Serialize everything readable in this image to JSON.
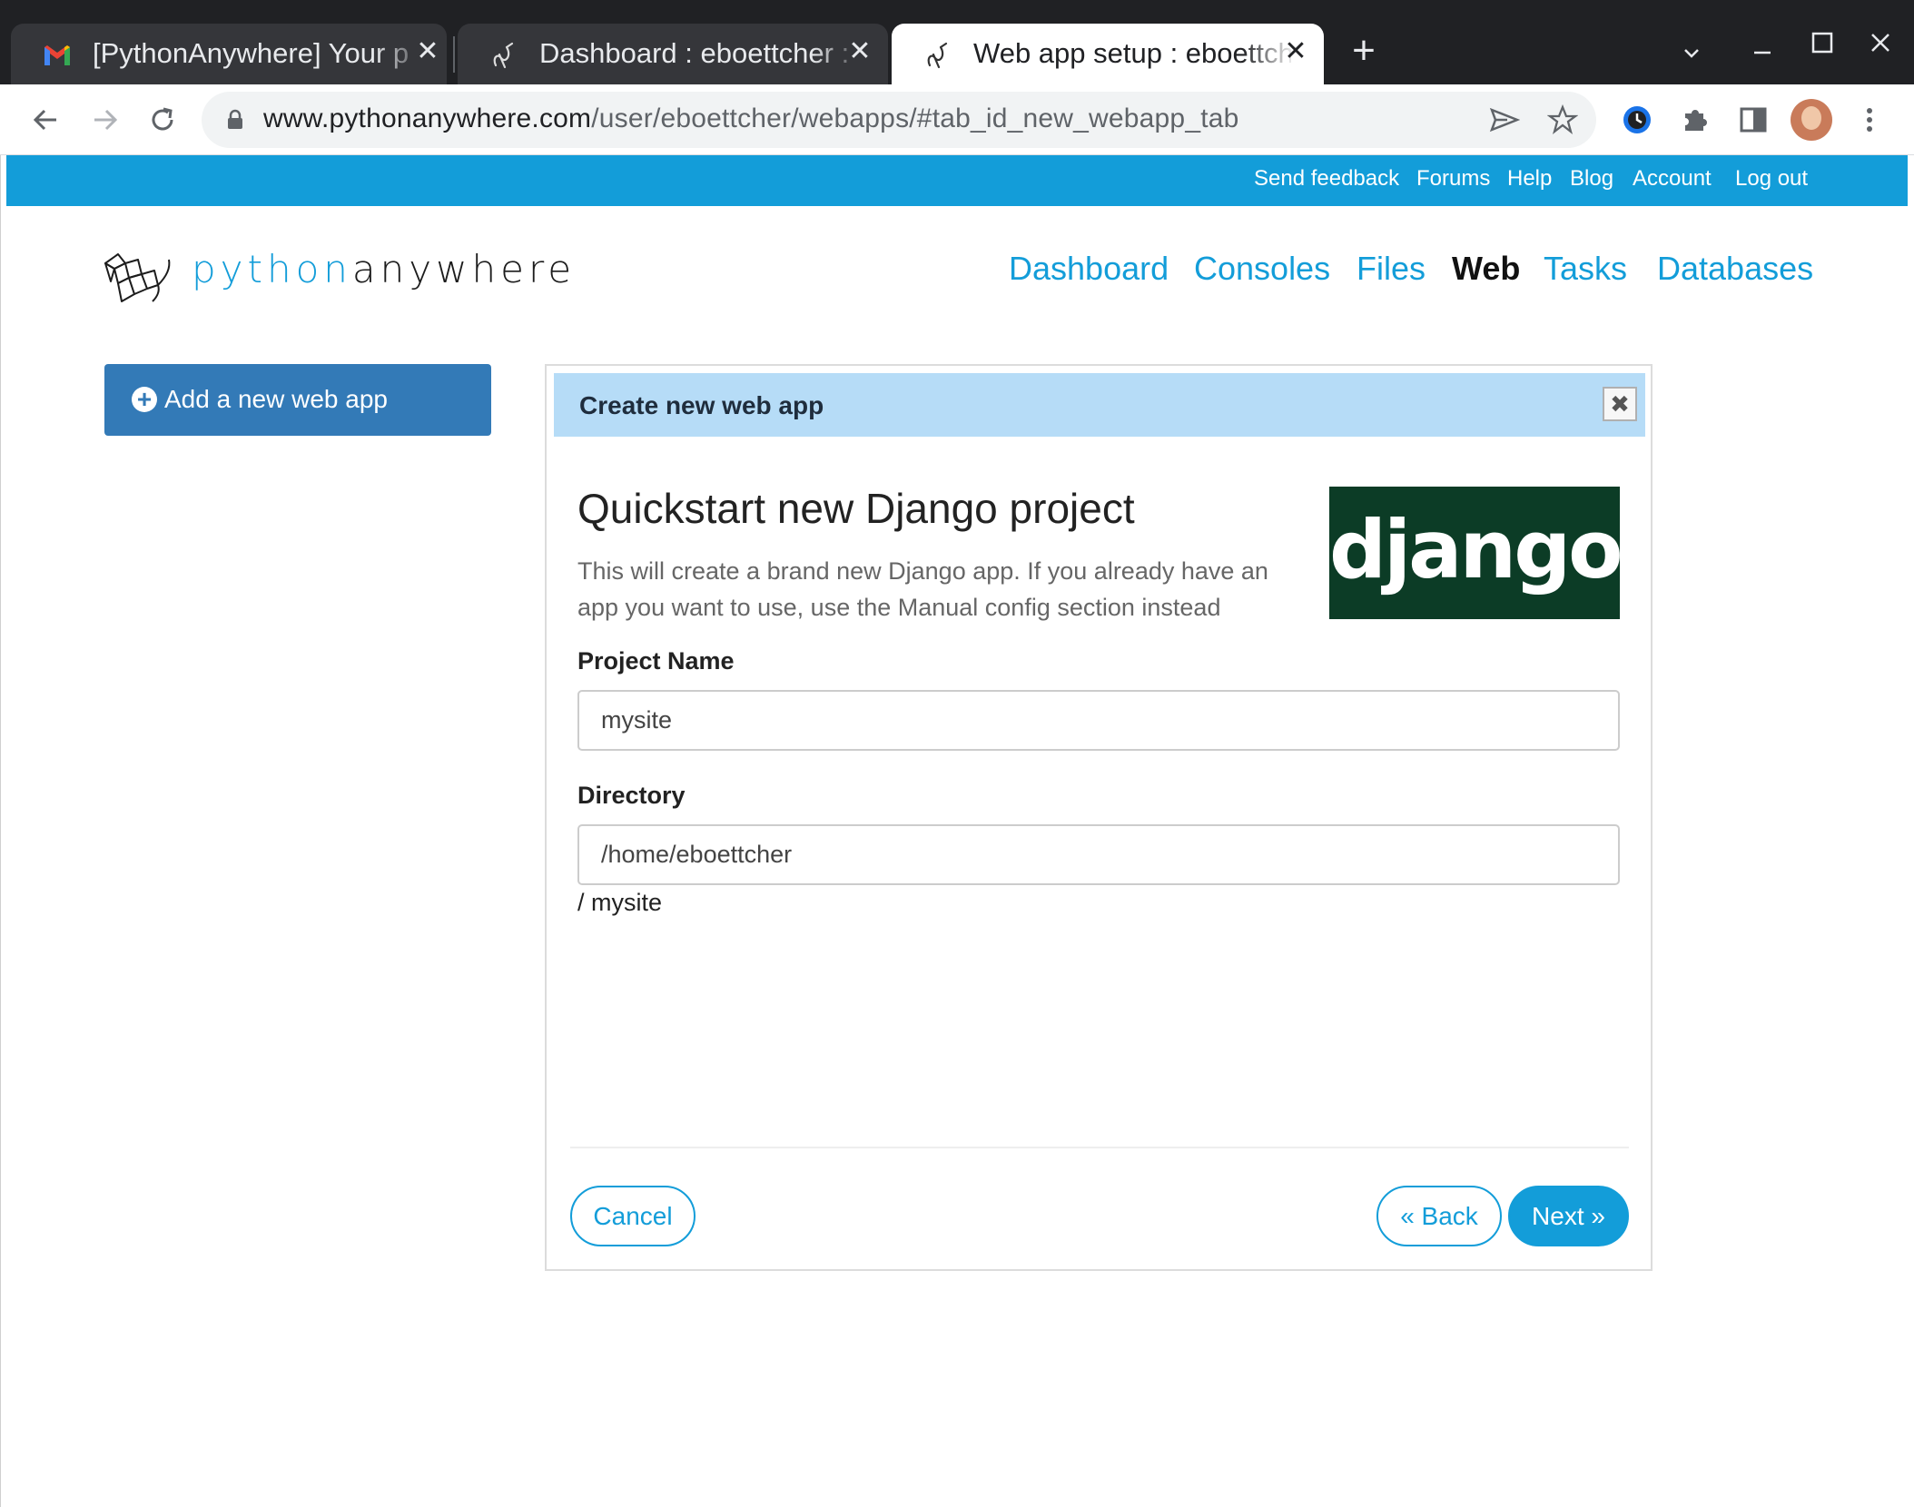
{
  "browser": {
    "tabs": [
      {
        "title": "[PythonAnywhere] Your p",
        "icon": "gmail-icon",
        "active": false
      },
      {
        "title": "Dashboard : eboettcher : I",
        "icon": "pythonanywhere-icon",
        "active": false
      },
      {
        "title": "Web app setup : eboettch",
        "icon": "pythonanywhere-icon",
        "active": true
      }
    ],
    "new_tab_glyph": "+",
    "tab_close_glyph": "✕",
    "url_host": "www.pythonanywhere.com",
    "url_path": "/user/eboettcher/webapps/#tab_id_new_webapp_tab"
  },
  "site": {
    "top_links": [
      "Send feedback",
      "Forums",
      "Help",
      "Blog",
      "Account",
      "Log out"
    ],
    "logo_part1": "python",
    "logo_part2": "anywhere",
    "nav": [
      {
        "label": "Dashboard",
        "active": false
      },
      {
        "label": "Consoles",
        "active": false
      },
      {
        "label": "Files",
        "active": false
      },
      {
        "label": "Web",
        "active": true
      },
      {
        "label": "Tasks",
        "active": false
      },
      {
        "label": "Databases",
        "active": false
      }
    ],
    "add_button": "Add a new web app",
    "add_button_glyph": "+"
  },
  "dialog": {
    "title": "Create new web app",
    "close_glyph": "✖",
    "heading": "Quickstart new Django project",
    "description": "This will create a brand new Django app. If you already have an app you want to use, use the Manual config section instead",
    "logo_text": "django",
    "project_name_label": "Project Name",
    "project_name_value": "mysite",
    "directory_label": "Directory",
    "directory_value": "/home/eboettcher",
    "directory_suffix": "/ mysite",
    "cancel_label": "Cancel",
    "back_label": "« Back",
    "next_label": "Next »"
  },
  "colors": {
    "brand_blue": "#139dd9",
    "button_blue": "#337ab7",
    "header_blue": "#b6dcf7",
    "django_green": "#0c3c26"
  }
}
